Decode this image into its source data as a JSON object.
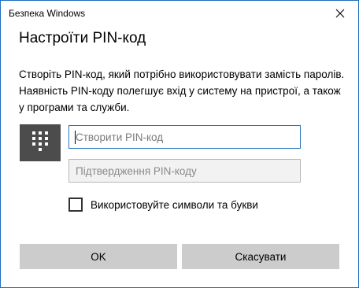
{
  "window": {
    "title": "Безпека Windows",
    "close_icon": "close-icon"
  },
  "dialog": {
    "heading": "Настроїти PIN-код",
    "description": "Створіть PIN-код, який потрібно використовувати замість паролів. Наявність PIN-коду полегшує вхід у систему на пристрої, а також у програми та служби.",
    "keypad_icon": "keypad-icon",
    "pin_field": {
      "placeholder": "Створити PIN-код",
      "value": ""
    },
    "confirm_field": {
      "placeholder": "Підтвердження PIN-коду",
      "value": ""
    },
    "checkbox": {
      "label": "Використовуйте символи та букви",
      "checked": false
    },
    "buttons": {
      "ok": "OK",
      "cancel": "Скасувати"
    }
  },
  "colors": {
    "border_accent": "#1f6fbf",
    "focus_border": "#2672c4",
    "keypad_tile": "#4c4c4c",
    "button_bg": "#cccccc"
  }
}
